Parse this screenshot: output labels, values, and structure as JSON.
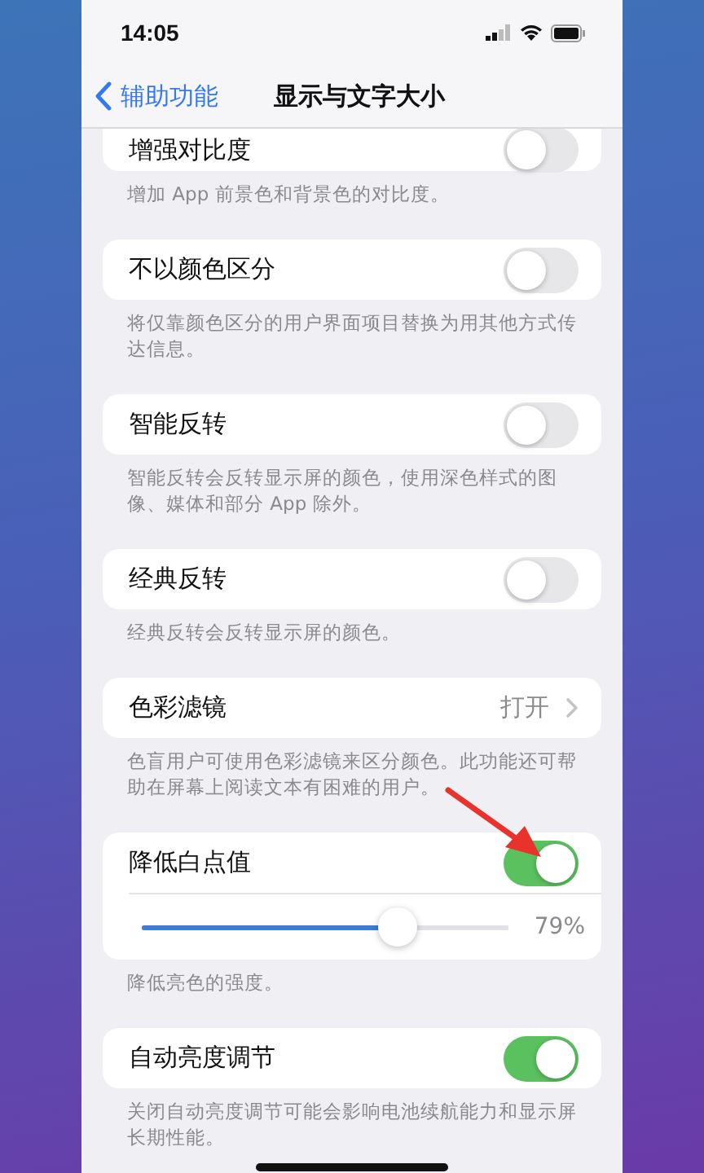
{
  "status_bar": {
    "time": "14:05"
  },
  "nav": {
    "back": "辅助功能",
    "title": "显示与文字大小"
  },
  "sections": [
    {
      "kind": "toggle",
      "label": "增强对比度",
      "on": false,
      "footer": "增加 App 前景色和背景色的对比度。"
    },
    {
      "kind": "toggle",
      "label": "不以颜色区分",
      "on": false,
      "footer": "将仅靠颜色区分的用户界面项目替换为用其他方式传达信息。"
    },
    {
      "kind": "toggle",
      "label": "智能反转",
      "on": false,
      "footer": "智能反转会反转显示屏的颜色，使用深色样式的图像、媒体和部分 App 除外。"
    },
    {
      "kind": "toggle",
      "label": "经典反转",
      "on": false,
      "footer": "经典反转会反转显示屏的颜色。"
    },
    {
      "kind": "link",
      "label": "色彩滤镜",
      "value": "打开",
      "footer": "色盲用户可使用色彩滤镜来区分颜色。此功能还可帮助在屏幕上阅读文本有困难的用户。"
    },
    {
      "kind": "toggle_slider",
      "label": "降低白点值",
      "on": true,
      "level": 0.7,
      "reading": "79%",
      "footer": "降低亮色的强度。"
    },
    {
      "kind": "toggle",
      "label": "自动亮度调节",
      "on": true,
      "footer": "关闭自动亮度调节可能会影响电池续航能力和显示屏长期性能。"
    }
  ]
}
